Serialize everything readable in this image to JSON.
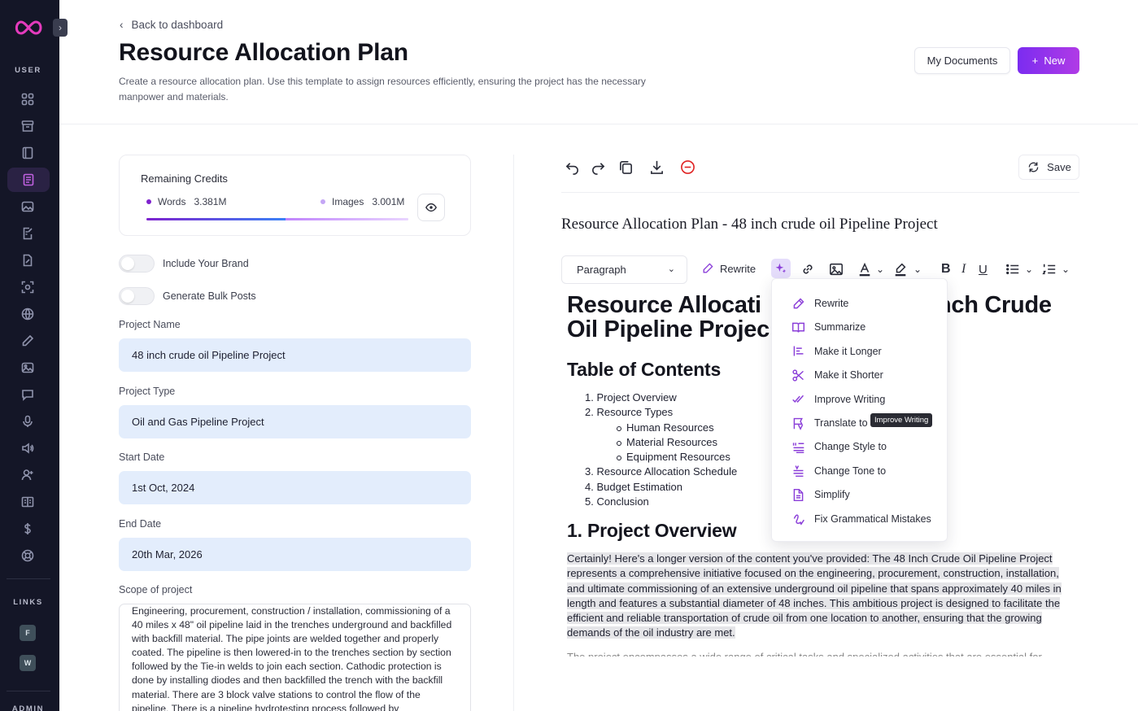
{
  "sidebar": {
    "section_user": "USER",
    "section_links": "LINKS",
    "section_admin": "ADMIN",
    "links": [
      "F",
      "W"
    ],
    "icons": [
      "dashboard-icon",
      "archive-icon",
      "book-icon",
      "document-icon",
      "image-icon",
      "document-edit-icon",
      "file-pen-icon",
      "scan-icon",
      "www-icon",
      "pen-icon",
      "gallery-icon",
      "chat-icon",
      "microphone-icon",
      "speaker-icon",
      "user-plus-icon",
      "book-open-icon",
      "dollar-icon",
      "lifebuoy-icon"
    ]
  },
  "header": {
    "back_label": "Back to dashboard",
    "title": "Resource Allocation Plan",
    "description": "Create a resource allocation plan. Use this template to assign resources efficiently, ensuring the project has the necessary manpower and materials.",
    "my_documents": "My Documents",
    "new_label": "New"
  },
  "credits": {
    "title": "Remaining Credits",
    "words_label": "Words",
    "words_value": "3.381M",
    "images_label": "Images",
    "images_value": "3.001M",
    "words_fraction": 0.53,
    "images_fraction": 0.47,
    "colors": {
      "words": "#7e22ce",
      "images": "#c4a6f5"
    }
  },
  "form": {
    "toggle_brand": "Include Your Brand",
    "toggle_bulk": "Generate Bulk Posts",
    "project_name_label": "Project Name",
    "project_name_value": "48 inch crude oil Pipeline Project",
    "project_type_label": "Project Type",
    "project_type_value": "Oil and Gas Pipeline Project",
    "start_date_label": "Start Date",
    "start_date_value": "1st Oct, 2024",
    "end_date_label": "End Date",
    "end_date_value": "20th Mar, 2026",
    "scope_label": "Scope of project",
    "scope_value": "Engineering, procurement, construction / installation, commissioning of a 40 miles x 48\" oil pipeline laid in the trenches underground and backfilled with backfill material. The pipe joints are welded together and properly coated. The pipeline is then lowered-in to the trenches section by section followed by the Tie-in welds to join each section. Cathodic protection is done by installing diodes and then backfilled the trench with the backfill material. There are 3 block valve stations to control the flow of the pipeline. There is a pipeline hydrotesting process followed by"
  },
  "editor": {
    "save_label": "Save",
    "doc_title": "Resource Allocation Plan - 48 inch crude oil Pipeline Project",
    "paragraph_select": "Paragraph",
    "rewrite_label": "Rewrite",
    "heading_left": "Resource Allocati",
    "heading_right": "nch Crude",
    "heading_line2": "Oil Pipeline Projec",
    "toc_heading": "Table of Contents",
    "toc": [
      {
        "num": "1.",
        "text": "Project Overview",
        "level": 1
      },
      {
        "num": "2.",
        "text": "Resource Types",
        "level": 1
      },
      {
        "num": "",
        "text": "Human Resources",
        "level": 2
      },
      {
        "num": "",
        "text": "Material Resources",
        "level": 2
      },
      {
        "num": "",
        "text": "Equipment Resources",
        "level": 2
      },
      {
        "num": "3.",
        "text": "Resource Allocation Schedule",
        "level": 1
      },
      {
        "num": "4.",
        "text": "Budget Estimation",
        "level": 1
      },
      {
        "num": "5.",
        "text": "Conclusion",
        "level": 1
      }
    ],
    "overview_heading": "1. Project Overview",
    "overview_text": "Certainly! Here's a longer version of the content you've provided: The 48 Inch Crude Oil Pipeline Project represents a comprehensive initiative focused on the engineering, procurement, construction, installation, and ultimate commissioning of an extensive underground oil pipeline that spans approximately 40 miles in length and features a substantial diameter of 48 inches. This ambitious project is designed to facilitate the efficient and reliable transportation of crude oil from one location to another, ensuring that the growing demands of the oil industry are met.",
    "faded_text": "The project encompasses a wide range of critical tasks and specialized activities that are essential for the"
  },
  "ai_menu": {
    "items": [
      {
        "label": "Rewrite",
        "icon": "pen-icon"
      },
      {
        "label": "Summarize",
        "icon": "book-open-icon"
      },
      {
        "label": "Make it Longer",
        "icon": "text-longer-icon"
      },
      {
        "label": "Make it Shorter",
        "icon": "scissors-icon"
      },
      {
        "label": "Improve Writing",
        "icon": "double-check-icon"
      },
      {
        "label": "Translate to",
        "icon": "translate-icon"
      },
      {
        "label": "Change Style to",
        "icon": "style-icon"
      },
      {
        "label": "Change Tone to",
        "icon": "tone-icon"
      },
      {
        "label": "Simplify",
        "icon": "file-icon"
      },
      {
        "label": "Fix Grammatical Mistakes",
        "icon": "spell-check-icon"
      }
    ],
    "tooltip": "Improve Writing",
    "accent": "#8b3fd9"
  }
}
